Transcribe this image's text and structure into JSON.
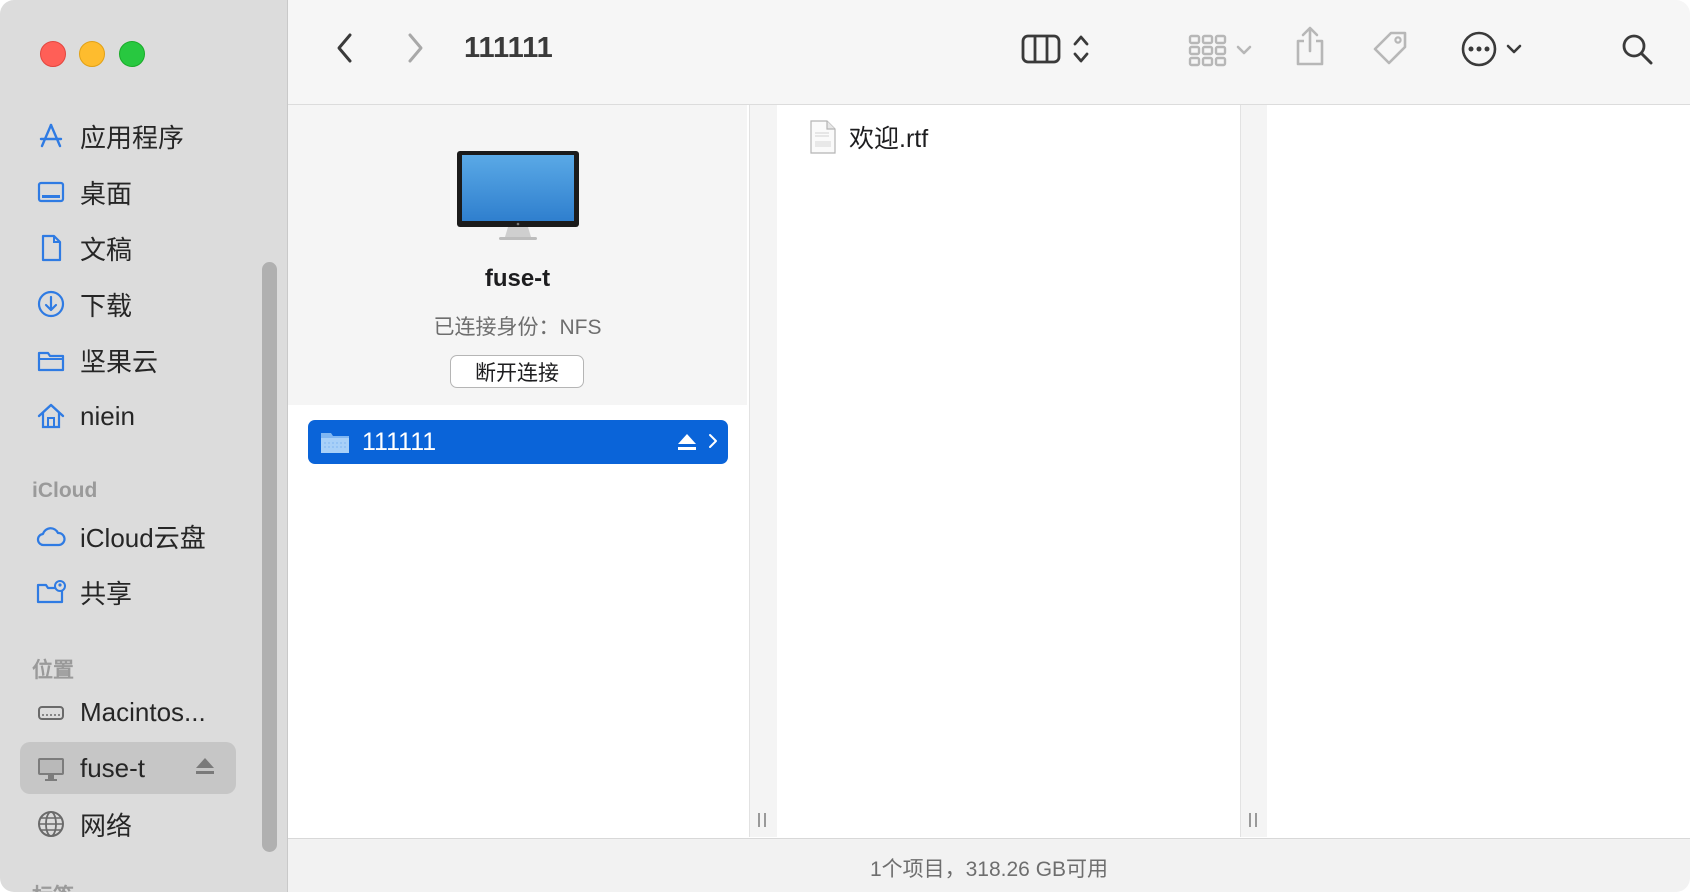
{
  "window": {
    "title": "111111"
  },
  "sidebar": {
    "favorites": [
      {
        "label": "应用程序",
        "icon": "applications-icon"
      },
      {
        "label": "桌面",
        "icon": "desktop-icon"
      },
      {
        "label": "文稿",
        "icon": "documents-icon"
      },
      {
        "label": "下载",
        "icon": "downloads-icon"
      },
      {
        "label": "坚果云",
        "icon": "folder-icon"
      },
      {
        "label": "niein",
        "icon": "home-icon"
      }
    ],
    "icloud_header": "iCloud",
    "icloud": [
      {
        "label": "iCloud云盘",
        "icon": "icloud-icon"
      },
      {
        "label": "共享",
        "icon": "shared-folder-icon"
      }
    ],
    "locations_header": "位置",
    "locations": [
      {
        "label": "Macintos...",
        "icon": "hard-drive-icon"
      },
      {
        "label": "fuse-t",
        "icon": "display-icon",
        "selected": true
      },
      {
        "label": "网络",
        "icon": "network-icon"
      }
    ],
    "tags_header": "标签"
  },
  "device": {
    "name": "fuse-t",
    "connection": "已连接身份：NFS",
    "disconnect_label": "断开连接"
  },
  "column1": {
    "selected_item": "111111"
  },
  "column2": {
    "file": "欢迎.rtf"
  },
  "status": {
    "text": "1个项目，318.26 GB可用"
  },
  "colors": {
    "accent": "#0a64d9",
    "sidebar_icon": "#2f7be3"
  }
}
